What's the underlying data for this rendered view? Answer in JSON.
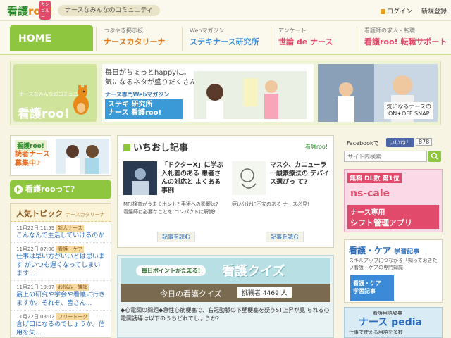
{
  "header": {
    "logo_text": "看護",
    "logo_roo": "roo!",
    "logo_tag": "カンゴルー",
    "slogan": "ナースなみんなのコミュニティ",
    "login": "ログイン",
    "register": "新規登録"
  },
  "nav": {
    "home": "HOME",
    "items": [
      {
        "sub": "つぶやき掲示板",
        "main": "ナースカタリーナ",
        "color": "#e07a20"
      },
      {
        "sub": "Webマガジン",
        "main": "ステキナース研究所",
        "color": "#3a8ad8"
      },
      {
        "sub": "アンケート",
        "main": "世論 de ナース",
        "color": "#e14a6a"
      },
      {
        "sub": "看護師の求人・転職",
        "main": "看護roo! 転職サポート",
        "color": "#e14a6a"
      }
    ]
  },
  "banner": {
    "left_sub": "ナースなみんなのコミュニティ",
    "left_logo": "看護roo!",
    "tagline": "毎日がちょっとhappyに。\n気になるネタが盛りだくさん。",
    "magazine_sub": "ナース専門Webマガジン",
    "magazine": "ステキ 研究所\nナース 看護roo!",
    "right_caption": "気になるナースの\nON✦OFF SNAP"
  },
  "left": {
    "recruit_logo": "看護roo!",
    "recruit_text": "読者ナース\n募集中♪",
    "what_button": "看護rooって?",
    "topics_title": "人気トピック",
    "topics_sub": "ナースカタリーナ",
    "topics": [
      {
        "date": "11月22日 11:59",
        "tag": "新人ナース",
        "title": "こんなんで生活していけるのか"
      },
      {
        "date": "11月22日 07:00",
        "tag": "看護・ケア",
        "title": "仕事は早い方がいいとは思います がいつも遅くなってしまいます..."
      },
      {
        "date": "11月21日 19:07",
        "tag": "お悩み・雑談",
        "title": "最上の研究や学会や看護に行きますか。それぞ、皆さん..."
      },
      {
        "date": "11月22日 03:02",
        "tag": "フリートーク",
        "title": "含げ口になるのでしょうか。信用を失..."
      }
    ]
  },
  "pickup": {
    "title": "いちおし記事",
    "source": "看護roo!",
    "articles": [
      {
        "title": "「ドクターX」に学ぶ 入札差のある 患者さんの対応と よくある事例",
        "desc": "MRI検査がうまくホント? 手術への影響は? 看護師に必要なことを コンパクトに解説!",
        "more": "記事を読む"
      },
      {
        "title": "マスク、カニューラ ー酸素療法の デバイス選びっ て?",
        "desc": "疲い分けに不安のある ナース必見!",
        "more": "記事を読む"
      }
    ]
  },
  "quiz": {
    "point": "毎日ポイントがたまる!",
    "title": "看護クイズ",
    "today": "今日の看護クイズ",
    "challengers": "挑戦者 4469 人",
    "question": "◆心電図の問題◆急性心筋梗塞で、右冠動脈の下壁梗塞を疑うST上昇が見 られる心電図誘導は以下のうちどれでしょうか?"
  },
  "right": {
    "facebook_label": "Facebookで",
    "like": "いいね！",
    "like_count": "878",
    "search_placeholder": "サイト内検索",
    "ad1_top": "無料 DL数 第1位",
    "ad1_brand": "ns-cale",
    "ad1_line1": "ナース専用",
    "ad1_line2": "シフト管理アプリ",
    "ad2_head": "看護・ケア",
    "ad2_sub": "学習記事",
    "ad2_desc": "スキルアップにつながる「知っておきた い看護・ケアの専門知識",
    "ad2_box": "看護・ケア\n学習記事",
    "ad3_sub": "看護用語辞典",
    "ad3_title": "ナース pedia",
    "ad3_desc": "仕事で使える用語を多数"
  }
}
